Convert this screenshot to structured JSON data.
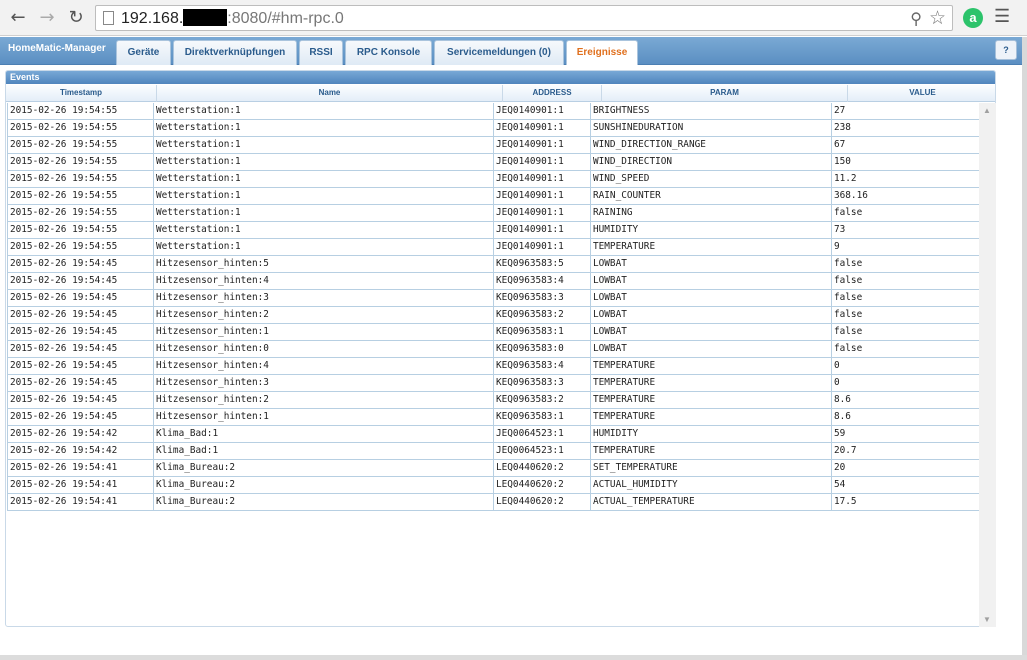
{
  "browser": {
    "url_prefix": "192.168.",
    "url_suffix": ":8080/#hm-rpc.0",
    "back_icon": "back-arrow-icon",
    "forward_icon": "forward-arrow-icon",
    "reload_icon": "reload-icon"
  },
  "app": {
    "title": "HomeMatic-Manager",
    "tabs": [
      {
        "label": "Geräte"
      },
      {
        "label": "Direktverknüpfungen"
      },
      {
        "label": "RSSI"
      },
      {
        "label": "RPC Konsole"
      },
      {
        "label": "Servicemeldungen (0)"
      },
      {
        "label": "Ereignisse",
        "active": true
      }
    ],
    "help_label": "?"
  },
  "events": {
    "panel_title": "Events",
    "columns": [
      "Timestamp",
      "Name",
      "ADDRESS",
      "PARAM",
      "VALUE"
    ],
    "rows": [
      [
        "2015-02-26 19:54:55",
        "Wetterstation:1",
        "JEQ0140901:1",
        "BRIGHTNESS",
        "27"
      ],
      [
        "2015-02-26 19:54:55",
        "Wetterstation:1",
        "JEQ0140901:1",
        "SUNSHINEDURATION",
        "238"
      ],
      [
        "2015-02-26 19:54:55",
        "Wetterstation:1",
        "JEQ0140901:1",
        "WIND_DIRECTION_RANGE",
        "67"
      ],
      [
        "2015-02-26 19:54:55",
        "Wetterstation:1",
        "JEQ0140901:1",
        "WIND_DIRECTION",
        "150"
      ],
      [
        "2015-02-26 19:54:55",
        "Wetterstation:1",
        "JEQ0140901:1",
        "WIND_SPEED",
        "11.2"
      ],
      [
        "2015-02-26 19:54:55",
        "Wetterstation:1",
        "JEQ0140901:1",
        "RAIN_COUNTER",
        "368.16"
      ],
      [
        "2015-02-26 19:54:55",
        "Wetterstation:1",
        "JEQ0140901:1",
        "RAINING",
        "false"
      ],
      [
        "2015-02-26 19:54:55",
        "Wetterstation:1",
        "JEQ0140901:1",
        "HUMIDITY",
        "73"
      ],
      [
        "2015-02-26 19:54:55",
        "Wetterstation:1",
        "JEQ0140901:1",
        "TEMPERATURE",
        "9"
      ],
      [
        "2015-02-26 19:54:45",
        "Hitzesensor_hinten:5",
        "KEQ0963583:5",
        "LOWBAT",
        "false"
      ],
      [
        "2015-02-26 19:54:45",
        "Hitzesensor_hinten:4",
        "KEQ0963583:4",
        "LOWBAT",
        "false"
      ],
      [
        "2015-02-26 19:54:45",
        "Hitzesensor_hinten:3",
        "KEQ0963583:3",
        "LOWBAT",
        "false"
      ],
      [
        "2015-02-26 19:54:45",
        "Hitzesensor_hinten:2",
        "KEQ0963583:2",
        "LOWBAT",
        "false"
      ],
      [
        "2015-02-26 19:54:45",
        "Hitzesensor_hinten:1",
        "KEQ0963583:1",
        "LOWBAT",
        "false"
      ],
      [
        "2015-02-26 19:54:45",
        "Hitzesensor_hinten:0",
        "KEQ0963583:0",
        "LOWBAT",
        "false"
      ],
      [
        "2015-02-26 19:54:45",
        "Hitzesensor_hinten:4",
        "KEQ0963583:4",
        "TEMPERATURE",
        "0"
      ],
      [
        "2015-02-26 19:54:45",
        "Hitzesensor_hinten:3",
        "KEQ0963583:3",
        "TEMPERATURE",
        "0"
      ],
      [
        "2015-02-26 19:54:45",
        "Hitzesensor_hinten:2",
        "KEQ0963583:2",
        "TEMPERATURE",
        "8.6"
      ],
      [
        "2015-02-26 19:54:45",
        "Hitzesensor_hinten:1",
        "KEQ0963583:1",
        "TEMPERATURE",
        "8.6"
      ],
      [
        "2015-02-26 19:54:42",
        "Klima_Bad:1",
        "JEQ0064523:1",
        "HUMIDITY",
        "59"
      ],
      [
        "2015-02-26 19:54:42",
        "Klima_Bad:1",
        "JEQ0064523:1",
        "TEMPERATURE",
        "20.7"
      ],
      [
        "2015-02-26 19:54:41",
        "Klima_Bureau:2",
        "LEQ0440620:2",
        "SET_TEMPERATURE",
        "20"
      ],
      [
        "2015-02-26 19:54:41",
        "Klima_Bureau:2",
        "LEQ0440620:2",
        "ACTUAL_HUMIDITY",
        "54"
      ],
      [
        "2015-02-26 19:54:41",
        "Klima_Bureau:2",
        "LEQ0440620:2",
        "ACTUAL_TEMPERATURE",
        "17.5"
      ]
    ]
  }
}
